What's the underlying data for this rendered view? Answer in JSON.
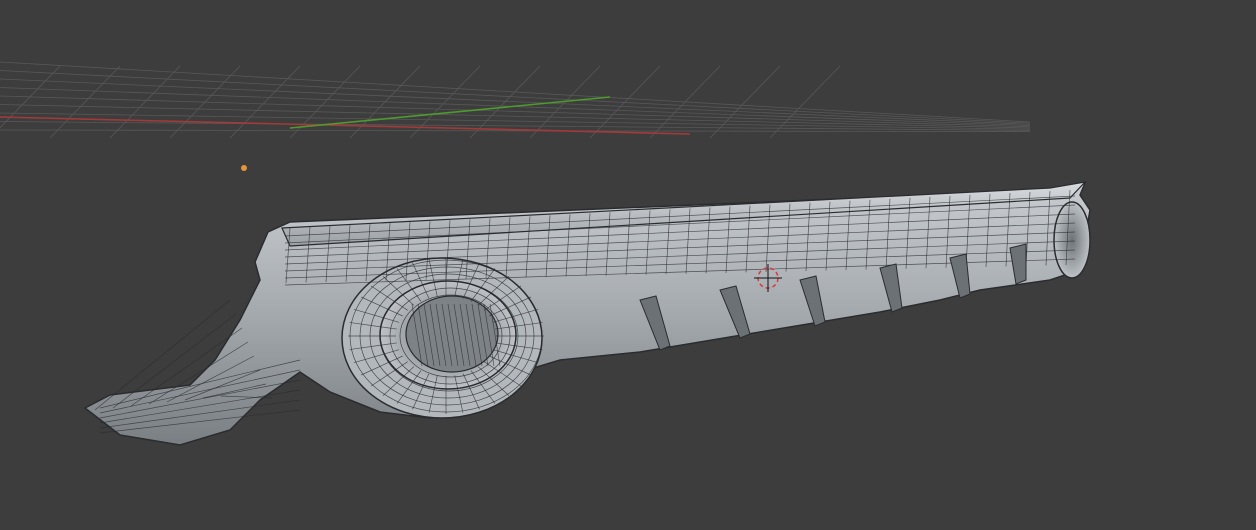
{
  "viewport": {
    "background": "#3d3d3d",
    "grid_color": "#585858",
    "x_axis_color": "#a33a3a",
    "y_axis_color": "#4f9a2e",
    "mesh_fill": "#9aa0a6",
    "mesh_highlight": "#c9cdd1",
    "mesh_shadow": "#6c7176",
    "wire_color": "#2a2c2f",
    "origin_color": "#e8953a",
    "cursor_color": "#d23b3b"
  },
  "scene": {
    "object": "rear-diffuser-mesh",
    "shading": "solid-wireframe"
  }
}
